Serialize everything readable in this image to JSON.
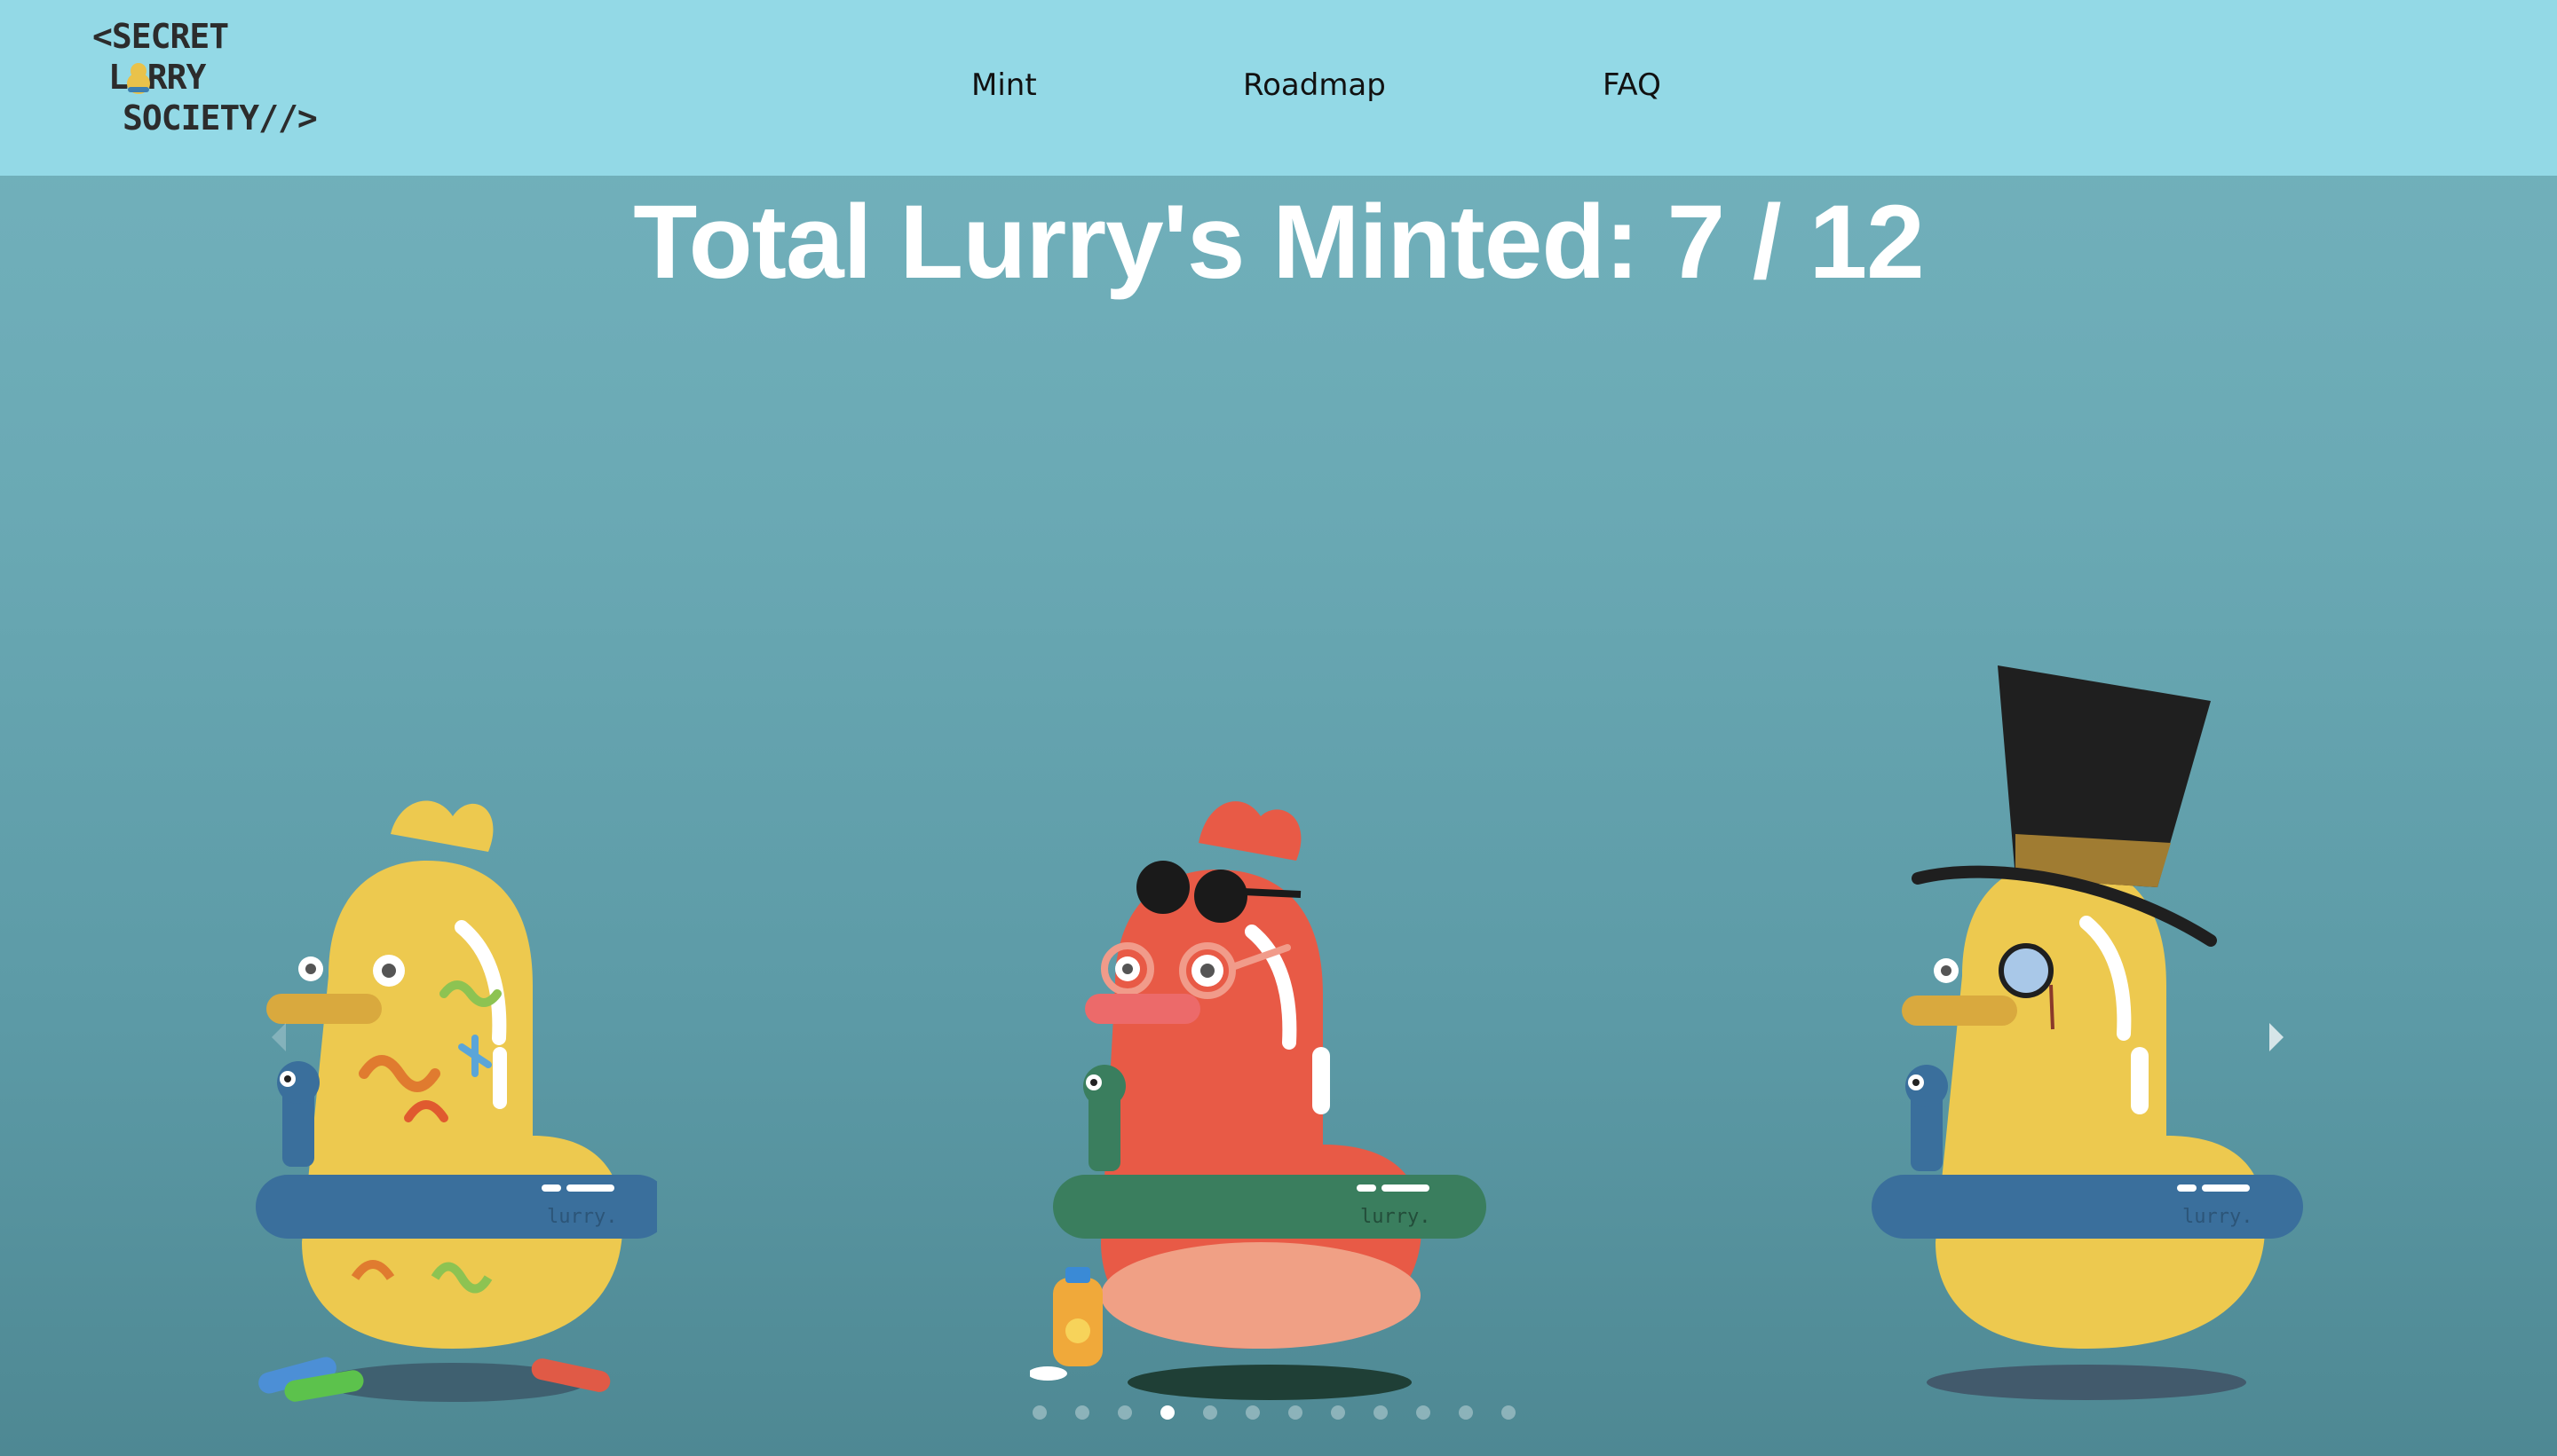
{
  "logo": {
    "line1": "<SECRET",
    "line2": "L  RRY",
    "line3": "SOCIETY//>"
  },
  "nav": {
    "mint": "Mint",
    "roadmap": "Roadmap",
    "faq": "FAQ"
  },
  "title": "Total Lurry's Minted: 7 / 12",
  "ducks": [
    {
      "name": "crayon-duck",
      "tag": "lurry."
    },
    {
      "name": "sunglasses-duck",
      "tag": "lurry."
    },
    {
      "name": "tophat-duck",
      "tag": "lurry."
    }
  ],
  "carousel": {
    "total_dots": 12,
    "active_dot": 4
  },
  "colors": {
    "header": "#93d9e6",
    "title": "#ffffff",
    "duck_yellow": "#edc94f",
    "duck_red": "#e85a46"
  }
}
